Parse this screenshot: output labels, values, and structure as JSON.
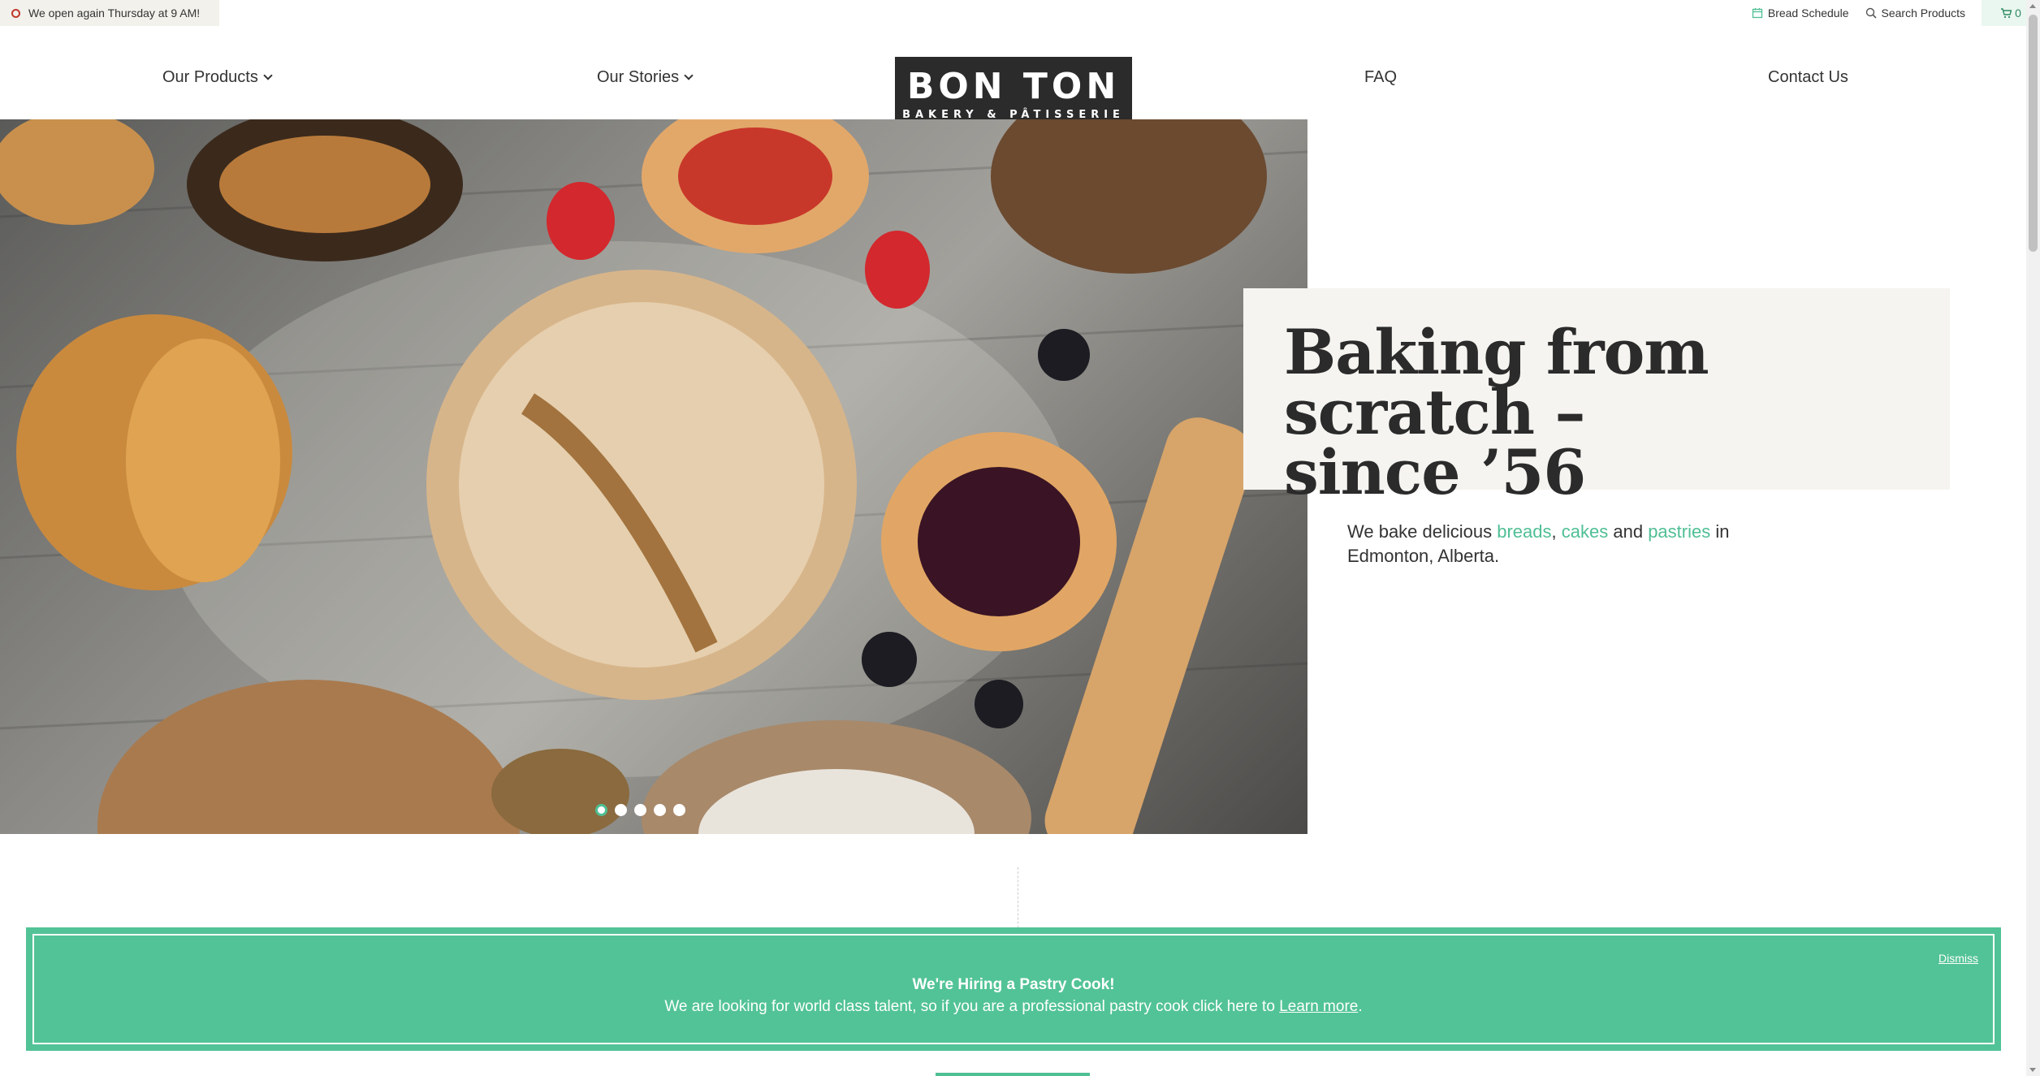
{
  "topbar": {
    "status": "We open again Thursday at 9 AM!",
    "bread_schedule": "Bread Schedule",
    "search_products": "Search Products",
    "cart_count": "0"
  },
  "nav": {
    "our_products": "Our Products",
    "our_stories": "Our Stories",
    "faq": "FAQ",
    "contact_us": "Contact Us"
  },
  "logo": {
    "main": "BON TON",
    "sub": "BAKERY & PÂTISSERIE"
  },
  "hero": {
    "title_line1": "Baking from scratch –",
    "title_line2": "since ’56",
    "text_prefix": "We bake delicious ",
    "link_breads": "breads",
    "sep1": ", ",
    "link_cakes": "cakes",
    "sep2": " and ",
    "link_pastries": "pastries",
    "text_suffix": " in Edmonton, Alberta.",
    "slides": 5,
    "active_slide": 1
  },
  "banner": {
    "title": "We're Hiring a Pastry Cook!",
    "text": "We are looking for world class talent, so if you are a professional pastry cook click here to ",
    "link": "Learn more",
    "text_end": ".",
    "dismiss": "Dismiss"
  },
  "colors": {
    "accent": "#4fbf94",
    "banner": "#52c396",
    "logo_bg": "#2b2b2b",
    "card_bg": "#f5f4f0"
  }
}
